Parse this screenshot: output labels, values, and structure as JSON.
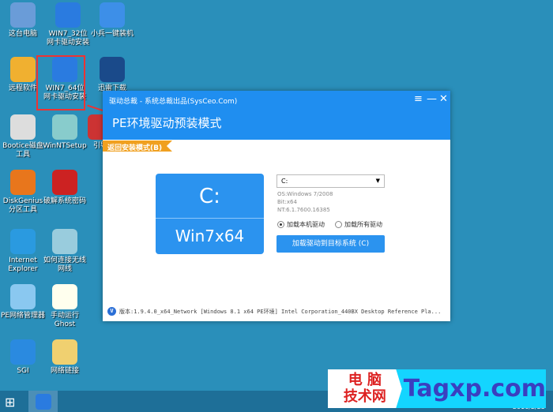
{
  "desktop_icons": [
    {
      "label": "这台电脑",
      "color": "#6a9cd8"
    },
    {
      "label": "WIN7_32位\n网卡驱动安装",
      "color": "#2a7be0"
    },
    {
      "label": "小兵一键装机",
      "color": "#3d8fe8"
    },
    {
      "label": "远程软件",
      "color": "#f0b030"
    },
    {
      "label": "WIN7_64位\n网卡驱动安装",
      "color": "#2a7be0"
    },
    {
      "label": "迅雷下载",
      "color": "#1a4a8a"
    },
    {
      "label": "Bootice磁盘\n工具",
      "color": "#ddd"
    },
    {
      "label": "WinNTSetup",
      "color": "#8cc"
    },
    {
      "label": "引导",
      "color": "#c33"
    },
    {
      "label": "DiskGenius\n分区工具",
      "color": "#e8761c"
    },
    {
      "label": "破解系统密码",
      "color": "#c22"
    },
    {
      "label": "Internet\nExplorer",
      "color": "#2a9ae0"
    },
    {
      "label": "如何连接无线\n网线",
      "color": "#9cd"
    },
    {
      "label": "PE网络管理器",
      "color": "#8ac8f0"
    },
    {
      "label": "手动运行\nGhost",
      "color": "#ffe"
    },
    {
      "label": "SGI",
      "color": "#2a8ae0"
    },
    {
      "label": "网络链接",
      "color": "#f0d070"
    }
  ],
  "window": {
    "title": "驱动总裁 - 系统总裁出品(SysCeo.Com)",
    "heading": "PE环境驱动预装模式",
    "back_tab": "返回安装模式(B)",
    "drive": "C:",
    "os": "Win7x64",
    "dropdown_value": "C:",
    "info": [
      "OS:Windows 7/2008",
      "Bit:x64",
      "NT:6.1.7600.16385"
    ],
    "radio_local": "加载本机驱动",
    "radio_all": "加载所有驱动",
    "radio_selected": "local",
    "load_button": "加载驱动到目标系统 (C)",
    "footer": "版本:1.9.4.0_x64_Network [Windows 8.1 x64 PE环境] Intel Corporation_440BX Desktop Reference Pla...",
    "menu_icon": "≡",
    "min_icon": "—",
    "close_icon": "✕"
  },
  "taskbar": {
    "clock": "2016/2/25"
  },
  "watermark": {
    "cn": "电 脑\n技术网",
    "en": "Tagxp.com"
  }
}
